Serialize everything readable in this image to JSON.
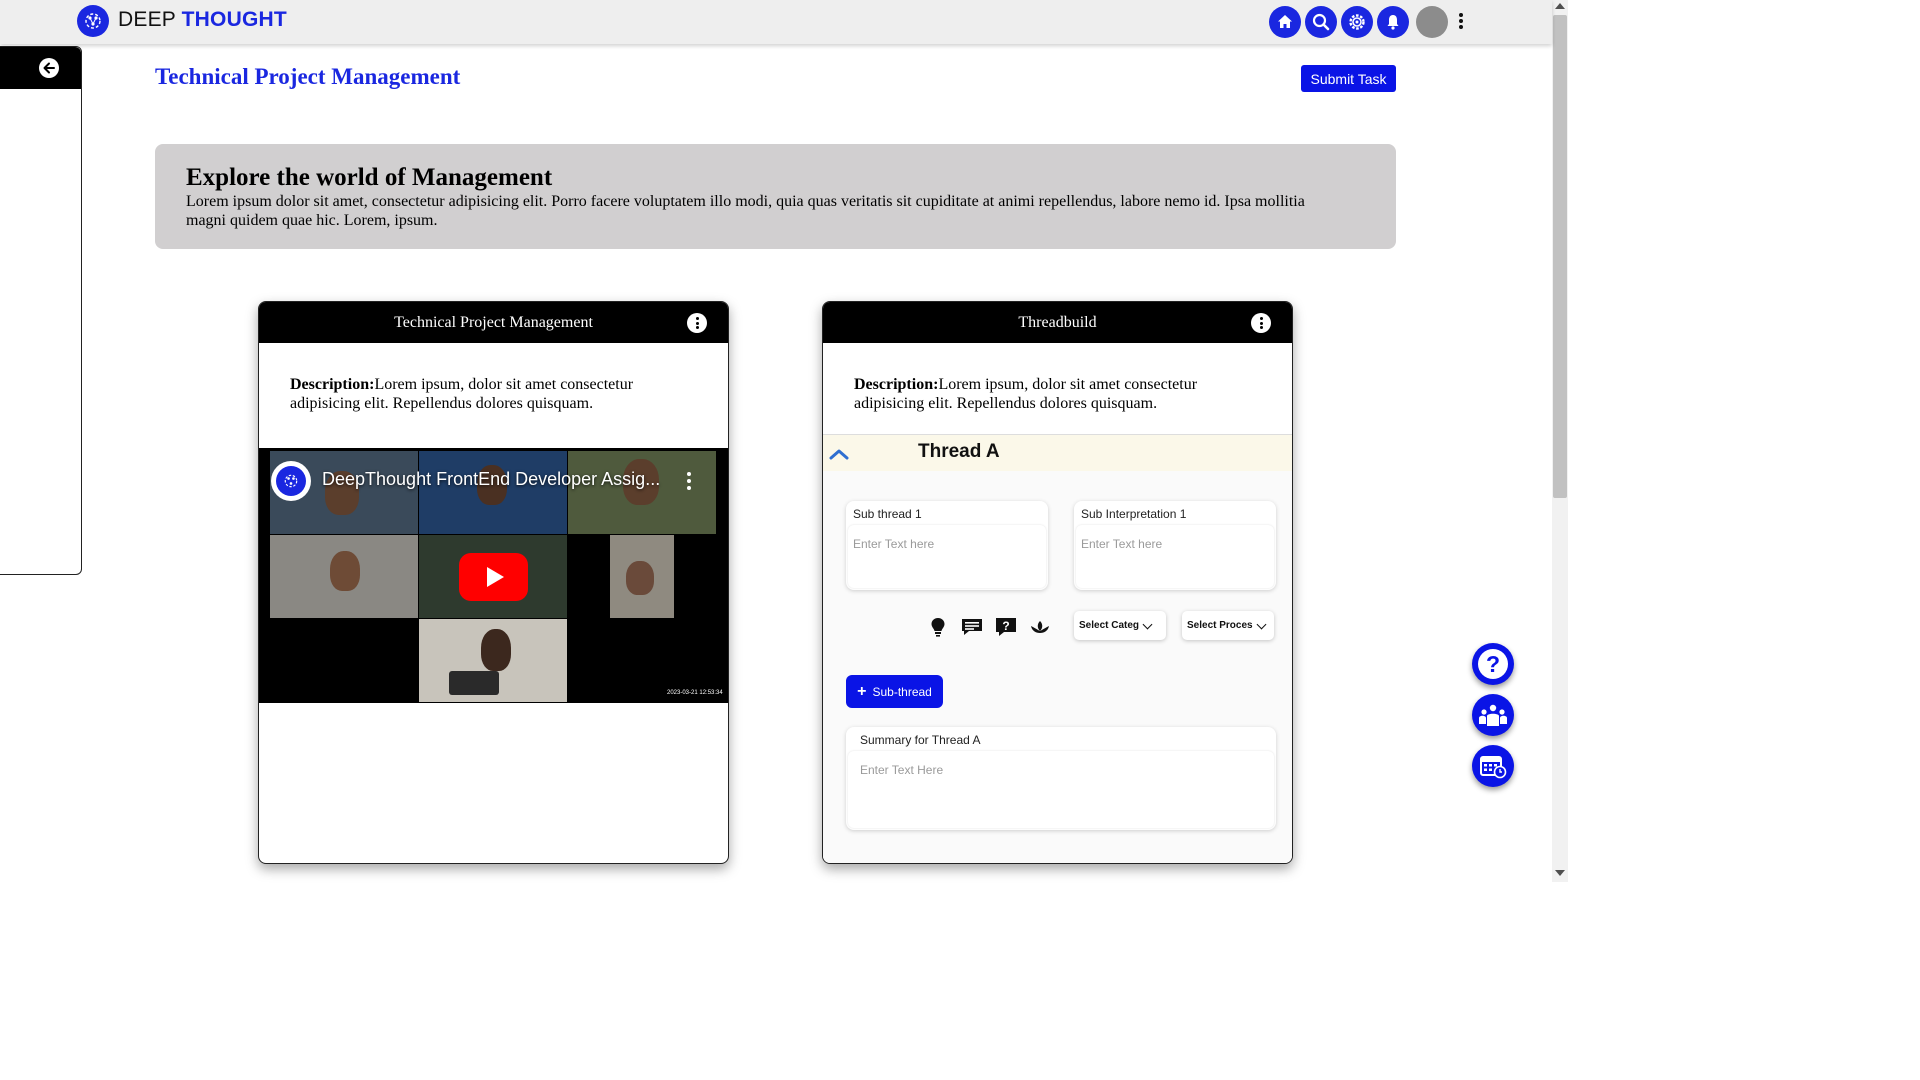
{
  "brand": {
    "word1": "DEEP",
    "word2": "THOUGHT"
  },
  "nav": {
    "icons": [
      "home-icon",
      "search-icon",
      "settings-icon",
      "bell-icon",
      "avatar",
      "kebab-icon"
    ]
  },
  "page": {
    "title": "Technical Project Management",
    "submit_label": "Submit Task"
  },
  "banner": {
    "heading": "Explore the world of Management",
    "body": "Lorem ipsum dolor sit amet, consectetur adipisicing elit. Porro facere voluptatem illo modi, quia quas veritatis sit cupiditate at animi repellendus, labore nemo id. Ipsa mollitia magni quidem quae hic. Lorem, ipsum."
  },
  "cards": [
    {
      "title": "Technical Project Management",
      "desc_label": "Description:",
      "desc_text": "Lorem ipsum, dolor sit amet consectetur adipisicing elit. Repellendus dolores quisquam.",
      "video": {
        "title": "DeepThought FrontEnd Developer Assig...",
        "timestamp": "2023-03-21 12:53:34"
      }
    },
    {
      "title": "Threadbuild",
      "desc_label": "Description:",
      "desc_text": "Lorem ipsum, dolor sit amet consectetur adipisicing elit. Repellendus dolores quisquam.",
      "thread": {
        "title": "Thread A",
        "sub_thread_label": "Sub thread 1",
        "sub_thread_placeholder": "Enter Text here",
        "sub_interp_label": "Sub Interpretation 1",
        "sub_interp_placeholder": "Enter Text here",
        "select_category": "Select Categ",
        "select_process": "Select Proces",
        "subthread_button": "Sub-thread",
        "summary_label": "Summary for Thread A",
        "summary_placeholder": "Enter Text Here"
      }
    }
  ],
  "colors": {
    "brand_blue": "#0a14e6",
    "banner_gray": "#d1cfd0"
  }
}
